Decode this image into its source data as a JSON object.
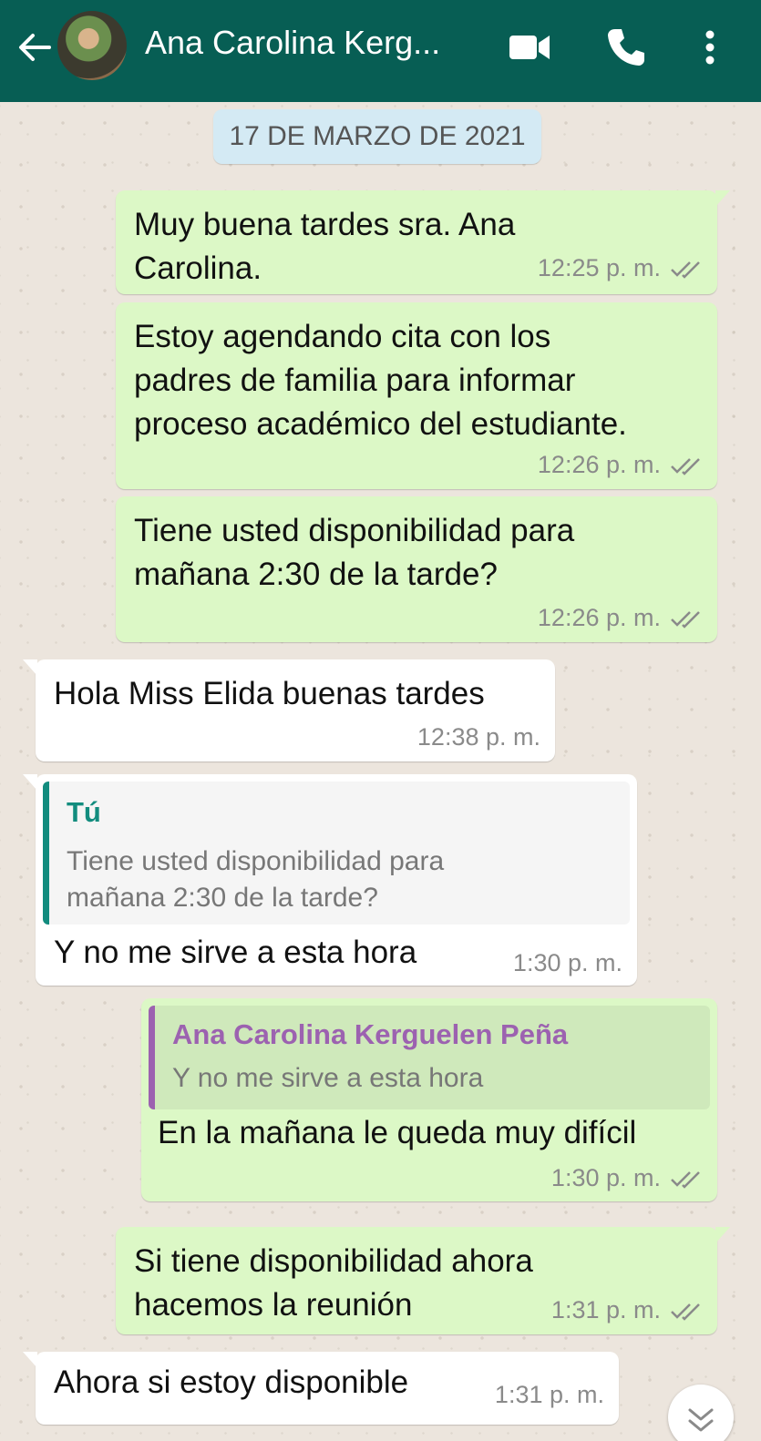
{
  "header": {
    "contact_name": "Ana Carolina Kerg...",
    "back_icon": "arrow-left-icon",
    "video_icon": "video-call-icon",
    "call_icon": "phone-icon",
    "menu_icon": "more-vertical-icon",
    "color": "#075e54"
  },
  "chat": {
    "date_label": "17 DE MARZO DE 2021",
    "messages": [
      {
        "dir": "out",
        "lines": [
          "Muy buena tardes sra. Ana",
          "Carolina."
        ],
        "time": "12:25 p. m."
      },
      {
        "dir": "out",
        "lines": [
          "Estoy agendando cita con los",
          "padres de familia para informar",
          "proceso académico del estudiante."
        ],
        "time": "12:26 p. m."
      },
      {
        "dir": "out",
        "lines": [
          "Tiene usted disponibilidad para",
          "mañana 2:30 de la tarde?"
        ],
        "time": "12:26 p. m."
      },
      {
        "dir": "in",
        "lines": [
          "Hola Miss Elida buenas tardes"
        ],
        "time": "12:38 p. m."
      },
      {
        "dir": "in",
        "quote_author": "Tú",
        "quote_lines": [
          "Tiene usted disponibilidad para",
          "mañana 2:30 de la tarde?"
        ],
        "lines": [
          "Y no me sirve a esta hora"
        ],
        "time": "1:30 p. m."
      },
      {
        "dir": "out",
        "quote_author": "Ana Carolina Kerguelen Peña",
        "quote_lines": [
          "Y no me sirve a esta hora"
        ],
        "lines": [
          "En la mañana le queda muy difícil"
        ],
        "time": "1:30 p. m."
      },
      {
        "dir": "out",
        "lines": [
          "Si tiene disponibilidad ahora",
          "hacemos la reunión"
        ],
        "time": "1:31 p. m."
      },
      {
        "dir": "in",
        "lines": [
          "Ahora si estoy disponible"
        ],
        "time": "1:31 p. m."
      }
    ],
    "scroll_icon": "double-chevron-down-icon",
    "colors": {
      "outgoing": "#dcf8c6",
      "incoming": "#ffffff",
      "tick": "#8a8a8a",
      "quote_you": "#128c7e",
      "quote_other": "#9c62b0"
    }
  }
}
